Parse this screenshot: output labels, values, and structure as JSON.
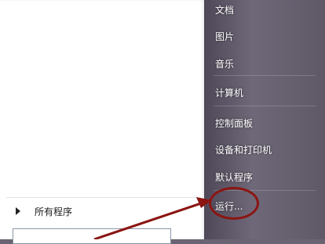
{
  "left_pane": {
    "all_programs_label": "所有程序"
  },
  "right_pane": {
    "items": [
      {
        "label": "文档"
      },
      {
        "label": "图片"
      },
      {
        "label": "音乐"
      },
      {
        "label": "计算机"
      },
      {
        "label": "控制面板"
      },
      {
        "label": "设备和打印机"
      },
      {
        "label": "默认程序"
      },
      {
        "label": "运行..."
      }
    ]
  },
  "annotation": {
    "circle_color": "#8b1512",
    "arrow_color": "#8b1512"
  }
}
